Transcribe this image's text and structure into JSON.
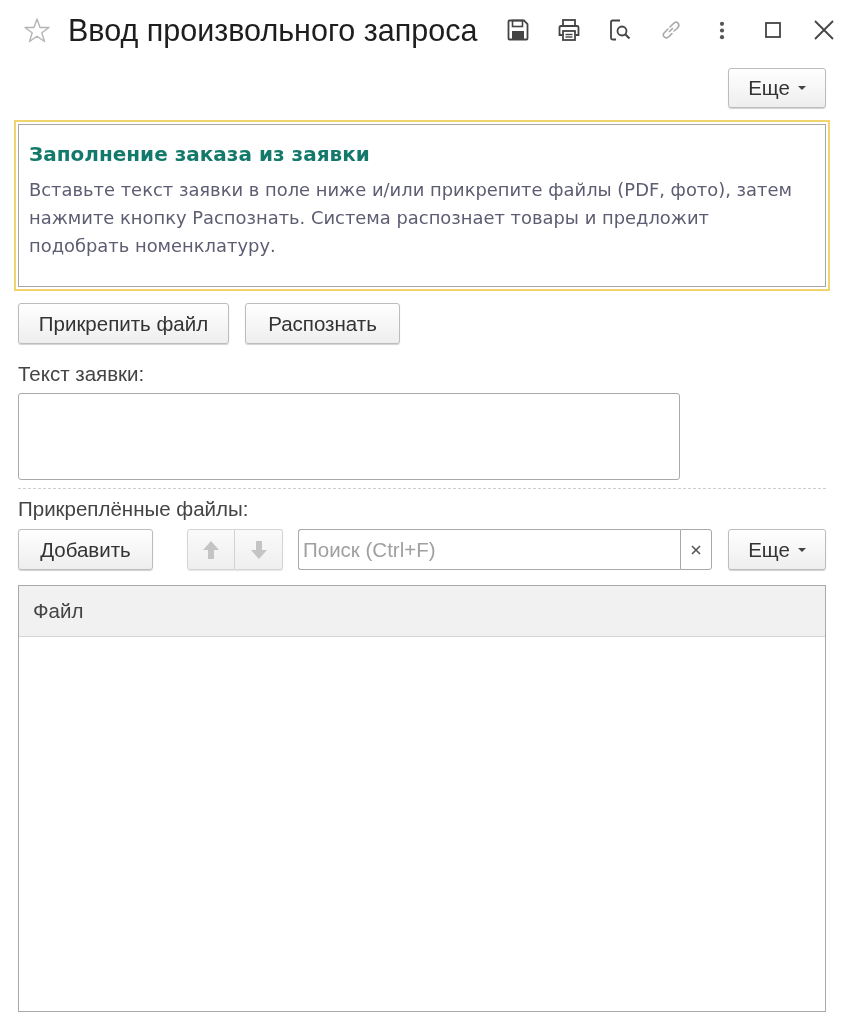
{
  "window": {
    "title": "Ввод произвольного запроса",
    "favorite": false
  },
  "form_menu": {
    "label": "Еще"
  },
  "info": {
    "title": "Заполнение заказа из заявки",
    "text": "Вставьте текст заявки в поле ниже и/или прикрепите файлы (PDF, фото), затем нажмите кнопку Распознать. Система распознает товары и предложит подобрать номенклатуру."
  },
  "actions": [
    {
      "label": "Прикрепить файл"
    },
    {
      "label": "Распознать"
    }
  ],
  "request_text": {
    "label": "Текст заявки:"
  },
  "attachments": {
    "label": "Прикреплённые файлы:",
    "toolbar": {
      "add": {
        "label": "Добавить"
      },
      "move_up": {
        "disabled": true
      },
      "move_down": {
        "disabled": true
      },
      "search": {
        "placeholder": "Поиск (Ctrl+F)"
      },
      "more": {
        "label": "Еще"
      }
    },
    "table": {
      "columns": [
        "Файл"
      ]
    }
  }
}
